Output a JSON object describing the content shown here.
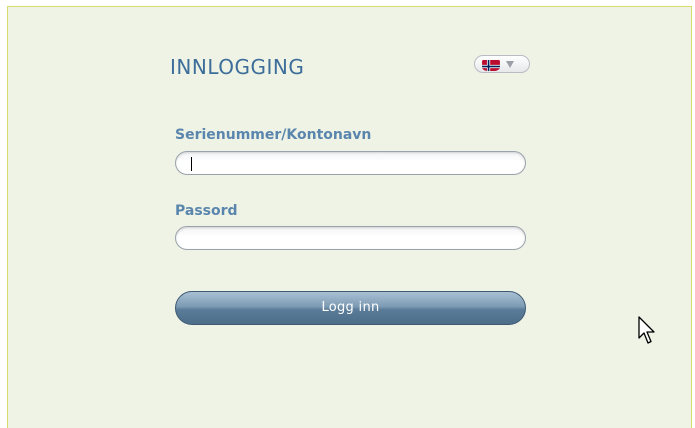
{
  "login": {
    "title": "INNLOGGING",
    "language_icon": "norway-flag-icon",
    "username_label": "Serienummer/Kontonavn",
    "username_value": "",
    "password_label": "Passord",
    "password_value": "",
    "submit_label": "Logg inn"
  },
  "colors": {
    "background": "#eff3e6",
    "border": "#d9dc6a",
    "title": "#3d6e9a",
    "label": "#5a86ad",
    "button": "#5b7c98"
  }
}
